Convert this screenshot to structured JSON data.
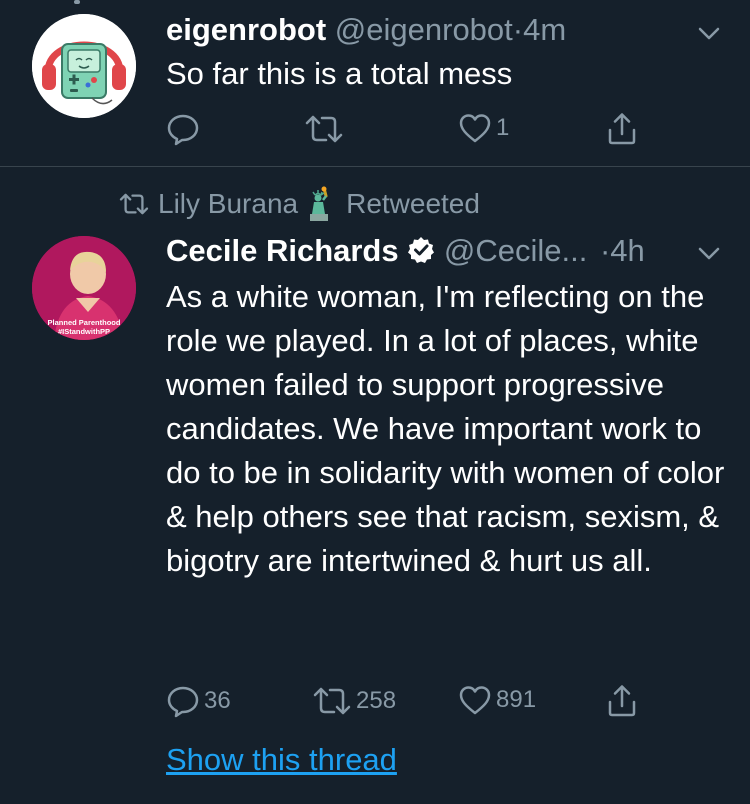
{
  "tweet1": {
    "name": "eigenrobot",
    "handle": "@eigenrobot",
    "separator": "·",
    "time": "4m",
    "text": "So far this is a total mess",
    "counts": {
      "reply": "",
      "retweet": "",
      "like": "1"
    }
  },
  "tweet2": {
    "retweeted_by": "Lily Burana",
    "retweeted_label": "Retweeted",
    "name": "Cecile Richards",
    "handle": "@Cecile...",
    "separator": "·",
    "time": "4h",
    "text": "As a white woman, I'm reflecting on the role we played. In a lot of places, white women failed to support progressive candidates. We have important work to do to be in solidarity with women of color & help others see that racism, sexism, & bigotry are intertwined & hurt us all.",
    "avatar_text": [
      "Planned Parenthood",
      "#IStandwithPP"
    ],
    "counts": {
      "reply": "36",
      "retweet": "258",
      "like": "891"
    },
    "show_thread": "Show this thread"
  },
  "colors": {
    "background": "#15202b",
    "secondary_text": "#8899a6",
    "link": "#1da1f2",
    "divider": "#38444d"
  }
}
